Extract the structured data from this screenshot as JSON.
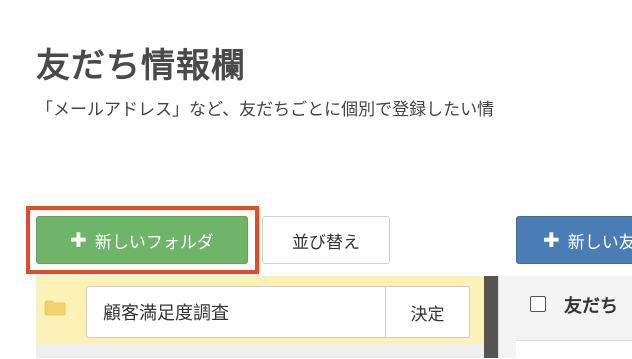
{
  "page": {
    "title": "友だち情報欄",
    "description": "「メールアドレス」など、友だちごとに個別で登録したい情"
  },
  "toolbar": {
    "new_folder_label": "新しいフォルダ",
    "sort_label": "並び替え",
    "new_item_label": "新しい友"
  },
  "folder_edit": {
    "input_value": "顧客満足度調査",
    "decide_label": "決定"
  },
  "list": {
    "header_label": "友だち"
  },
  "colors": {
    "green_button": "#6eb469",
    "blue_button": "#4a7db5",
    "highlight_border": "#e8482a",
    "folder_panel_bg": "#fcf1b7",
    "folder_icon": "#f2d36b"
  },
  "icons": {
    "plus": "plus-icon",
    "folder": "folder-icon"
  }
}
